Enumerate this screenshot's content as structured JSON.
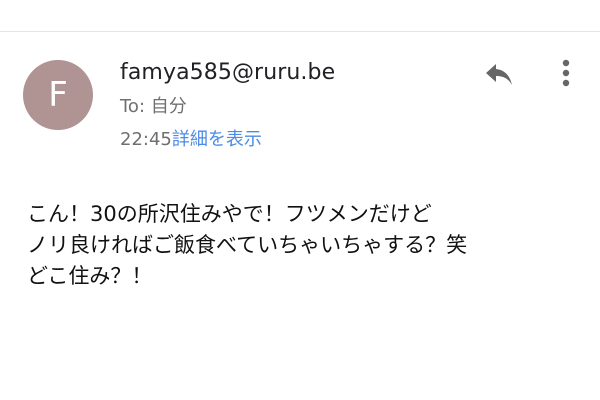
{
  "header": {
    "avatar_letter": "F",
    "avatar_color": "#b09393",
    "sender": "famya585@ruru.be",
    "recipient_prefix": "To: ",
    "recipient": "自分",
    "time": "22:45",
    "details_link": "詳細を表示",
    "actions": {
      "reply_icon": "reply-icon",
      "more_icon": "more-vertical-icon"
    }
  },
  "message": {
    "lines": [
      "こん！30の所沢住みやで！フツメンだけど",
      "ノリ良ければご飯食べていちゃいちゃする？笑",
      "どこ住み？！"
    ]
  },
  "colors": {
    "link": "#4c8be8",
    "secondary_text": "#6f6f6f",
    "divider": "#e5e5e5",
    "icon": "#666666"
  }
}
